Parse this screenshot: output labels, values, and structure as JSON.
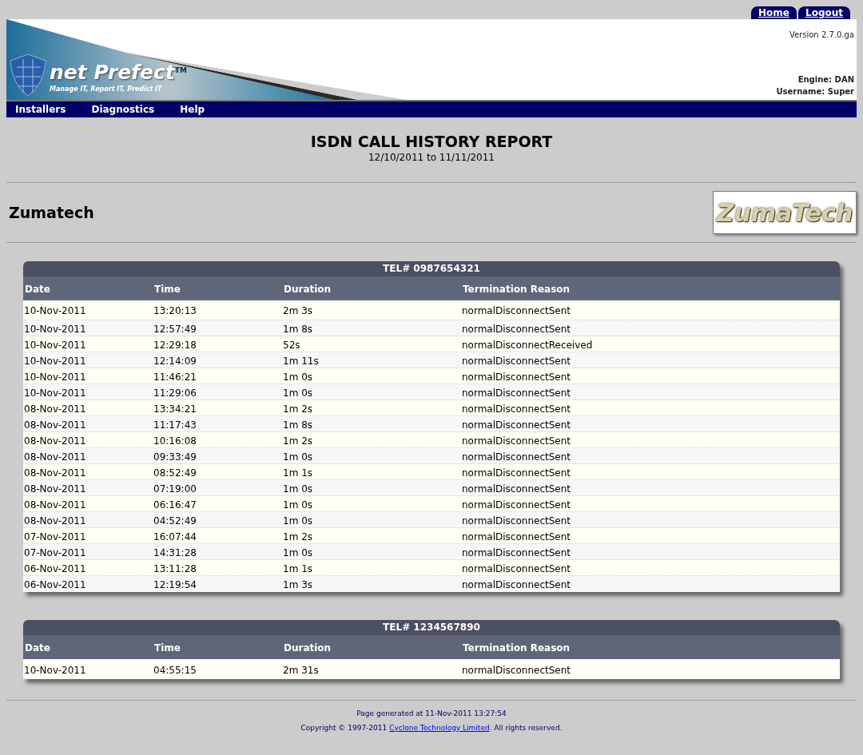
{
  "top_links": [
    "Home",
    "Logout"
  ],
  "logo": {
    "name": "net Prefect",
    "trademark": "TM",
    "tagline": "Manage IT, Report IT, Predict IT"
  },
  "version": "Version 2.7.0.ga",
  "engine": "Engine: DAN",
  "username": "Username: Super",
  "nav": [
    "Installers",
    "Diagnostics",
    "Help"
  ],
  "report": {
    "title": "ISDN CALL HISTORY REPORT",
    "range": "12/10/2011 to 11/11/2011"
  },
  "company": {
    "name": "Zumatech",
    "logo_text": "ZumaTech"
  },
  "tables": [
    {
      "title": "TEL# 0987654321",
      "columns": [
        "Date",
        "Time",
        "Duration",
        "Termination Reason"
      ],
      "rows": [
        [
          "10-Nov-2011",
          "13:20:13",
          "2m 3s",
          "normalDisconnectSent"
        ],
        [
          "10-Nov-2011",
          "12:57:49",
          "1m 8s",
          "normalDisconnectSent"
        ],
        [
          "10-Nov-2011",
          "12:29:18",
          "52s",
          "normalDisconnectReceived"
        ],
        [
          "10-Nov-2011",
          "12:14:09",
          "1m 11s",
          "normalDisconnectSent"
        ],
        [
          "10-Nov-2011",
          "11:46:21",
          "1m 0s",
          "normalDisconnectSent"
        ],
        [
          "10-Nov-2011",
          "11:29:06",
          "1m 0s",
          "normalDisconnectSent"
        ],
        [
          "08-Nov-2011",
          "13:34:21",
          "1m 2s",
          "normalDisconnectSent"
        ],
        [
          "08-Nov-2011",
          "11:17:43",
          "1m 8s",
          "normalDisconnectSent"
        ],
        [
          "08-Nov-2011",
          "10:16:08",
          "1m 2s",
          "normalDisconnectSent"
        ],
        [
          "08-Nov-2011",
          "09:33:49",
          "1m 0s",
          "normalDisconnectSent"
        ],
        [
          "08-Nov-2011",
          "08:52:49",
          "1m 1s",
          "normalDisconnectSent"
        ],
        [
          "08-Nov-2011",
          "07:19:00",
          "1m 0s",
          "normalDisconnectSent"
        ],
        [
          "08-Nov-2011",
          "06:16:47",
          "1m 0s",
          "normalDisconnectSent"
        ],
        [
          "08-Nov-2011",
          "04:52:49",
          "1m 0s",
          "normalDisconnectSent"
        ],
        [
          "07-Nov-2011",
          "16:07:44",
          "1m 2s",
          "normalDisconnectSent"
        ],
        [
          "07-Nov-2011",
          "14:31:28",
          "1m 0s",
          "normalDisconnectSent"
        ],
        [
          "06-Nov-2011",
          "13:11:28",
          "1m 1s",
          "normalDisconnectSent"
        ],
        [
          "06-Nov-2011",
          "12:19:54",
          "1m 3s",
          "normalDisconnectSent"
        ]
      ]
    },
    {
      "title": "TEL# 1234567890",
      "columns": [
        "Date",
        "Time",
        "Duration",
        "Termination Reason"
      ],
      "rows": [
        [
          "10-Nov-2011",
          "04:55:15",
          "2m 31s",
          "normalDisconnectSent"
        ]
      ]
    }
  ],
  "footer": {
    "generated": "Page generated at 11-Nov-2011 13:27:54",
    "copyright_prefix": "Copyright © 1997-2011 ",
    "link": "Cyclone Technology Limited",
    "copyright_suffix": ". All rights reserved."
  }
}
